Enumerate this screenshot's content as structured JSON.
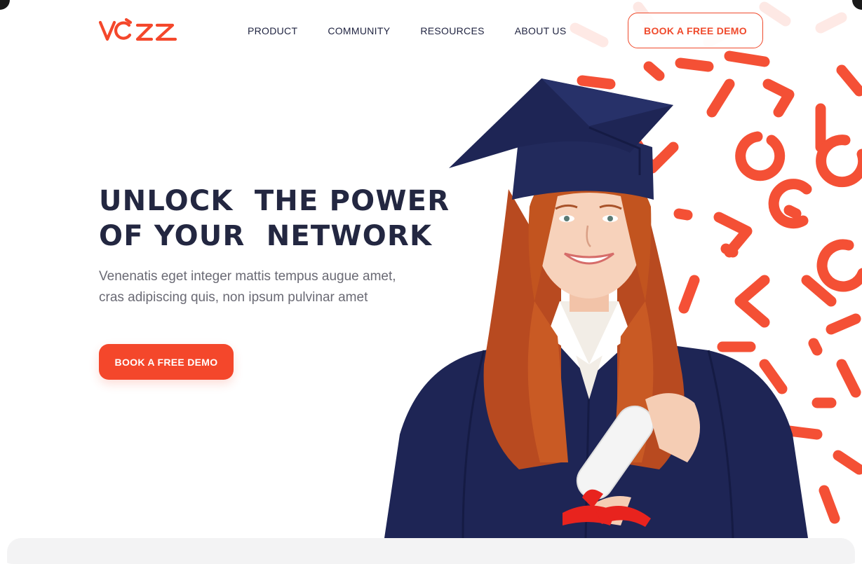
{
  "brand": {
    "name": "VOZZ",
    "accent_color": "#f4472b",
    "dark_color": "#232741"
  },
  "nav": {
    "items": [
      {
        "label": "PRODUCT"
      },
      {
        "label": "COMMUNITY"
      },
      {
        "label": "RESOURCES"
      },
      {
        "label": "ABOUT US"
      }
    ]
  },
  "header": {
    "cta_label": "BOOK A FREE DEMO"
  },
  "hero": {
    "headline_line1": "UNLOCK  THE POWER",
    "headline_line2": "OF YOUR  NETWORK",
    "subtext_line1": "Venenatis eget integer mattis tempus augue amet,",
    "subtext_line2": "cras adipiscing quis, non ipsum pulvinar amet",
    "cta_label": "BOOK A FREE DEMO",
    "image": "graduate-student-photo"
  }
}
